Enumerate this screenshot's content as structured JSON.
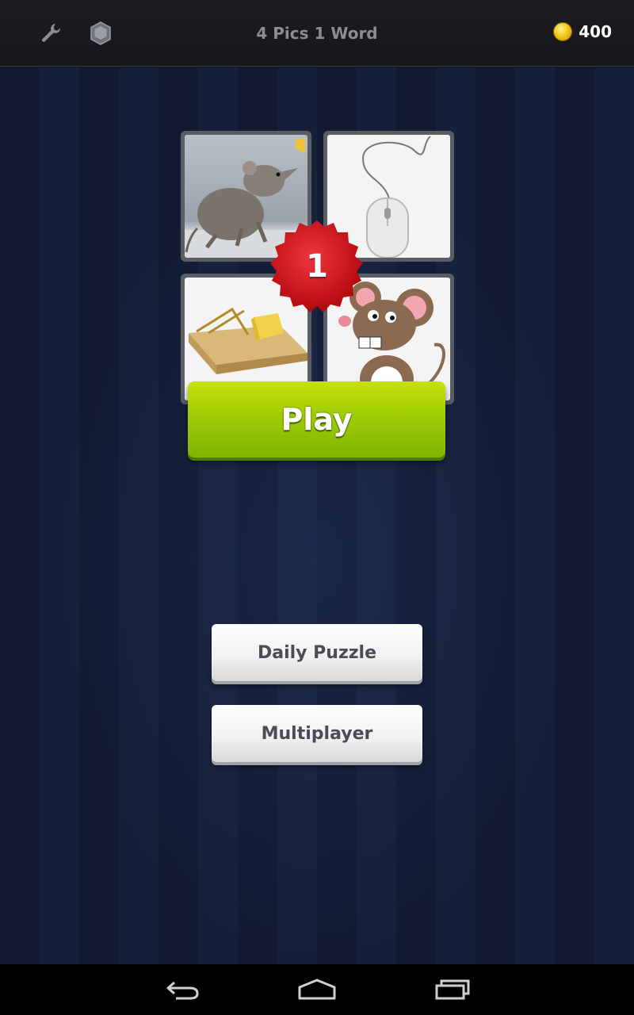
{
  "header": {
    "title": "4 Pics 1 Word",
    "coins": "400",
    "icons": [
      "wrench-icon",
      "hexagon-icon",
      "coin-icon"
    ]
  },
  "puzzle": {
    "level": "1",
    "pictures": [
      "mouse-animal",
      "computer-mouse",
      "mousetrap",
      "cartoon-mouse"
    ]
  },
  "buttons": {
    "play": "Play",
    "daily_puzzle": "Daily Puzzle",
    "multiplayer": "Multiplayer"
  },
  "navbar": {
    "icons": [
      "back-icon",
      "home-icon",
      "recent-apps-icon"
    ]
  },
  "colors": {
    "play_green": "#9fcc06",
    "badge_red": "#d8141c",
    "background": "#111a30"
  }
}
